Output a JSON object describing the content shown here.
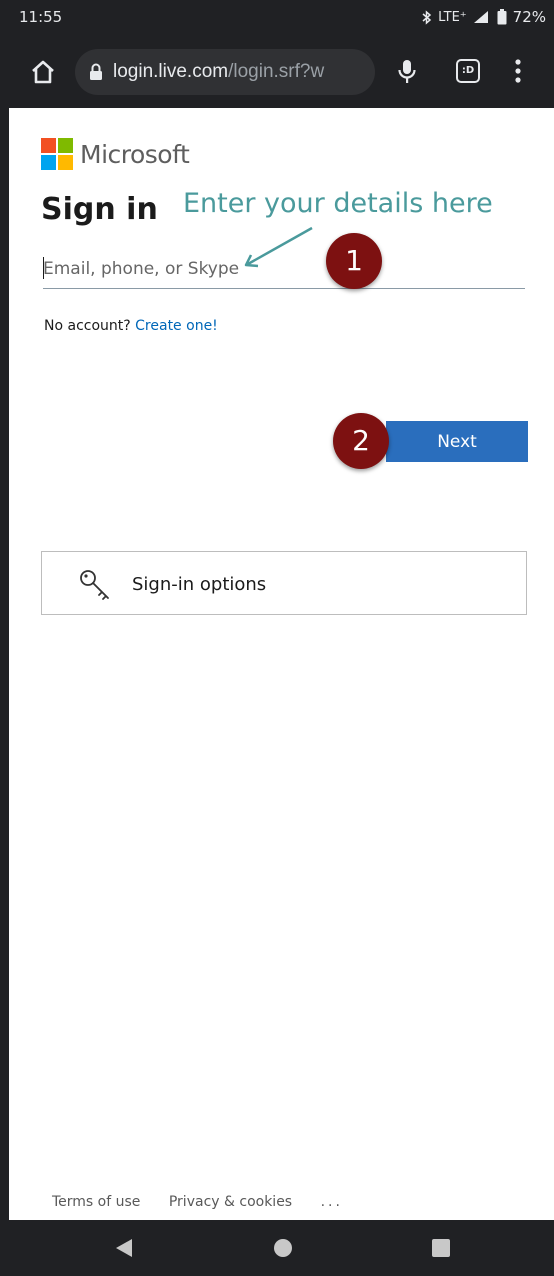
{
  "status_bar": {
    "time": "11:55",
    "network": "LTE⁺",
    "battery": "72%"
  },
  "browser": {
    "url_host": "login.live.com",
    "url_path": "/login.srf?w",
    "tabs_glyph": ":D"
  },
  "brand": {
    "name": "Microsoft",
    "logo_colors": [
      "#f25022",
      "#7fba00",
      "#00a4ef",
      "#ffb900"
    ]
  },
  "form": {
    "title": "Sign in",
    "email_placeholder": "Email, phone, or Skype",
    "email_value": "",
    "no_account_text": "No account?",
    "create_link": "Create one!",
    "next_label": "Next"
  },
  "annotations": {
    "hint_text": "Enter your details here",
    "step_1": "1",
    "step_2": "2",
    "hint_color": "#4a9a9c",
    "badge_color": "#7d1111"
  },
  "options": {
    "label": "Sign-in options",
    "icon": "key-icon"
  },
  "footer": {
    "terms": "Terms of use",
    "privacy": "Privacy & cookies",
    "more": "..."
  },
  "colors": {
    "accent": "#2a6ebd",
    "link": "#0067b8",
    "system_bar": "#202124"
  }
}
